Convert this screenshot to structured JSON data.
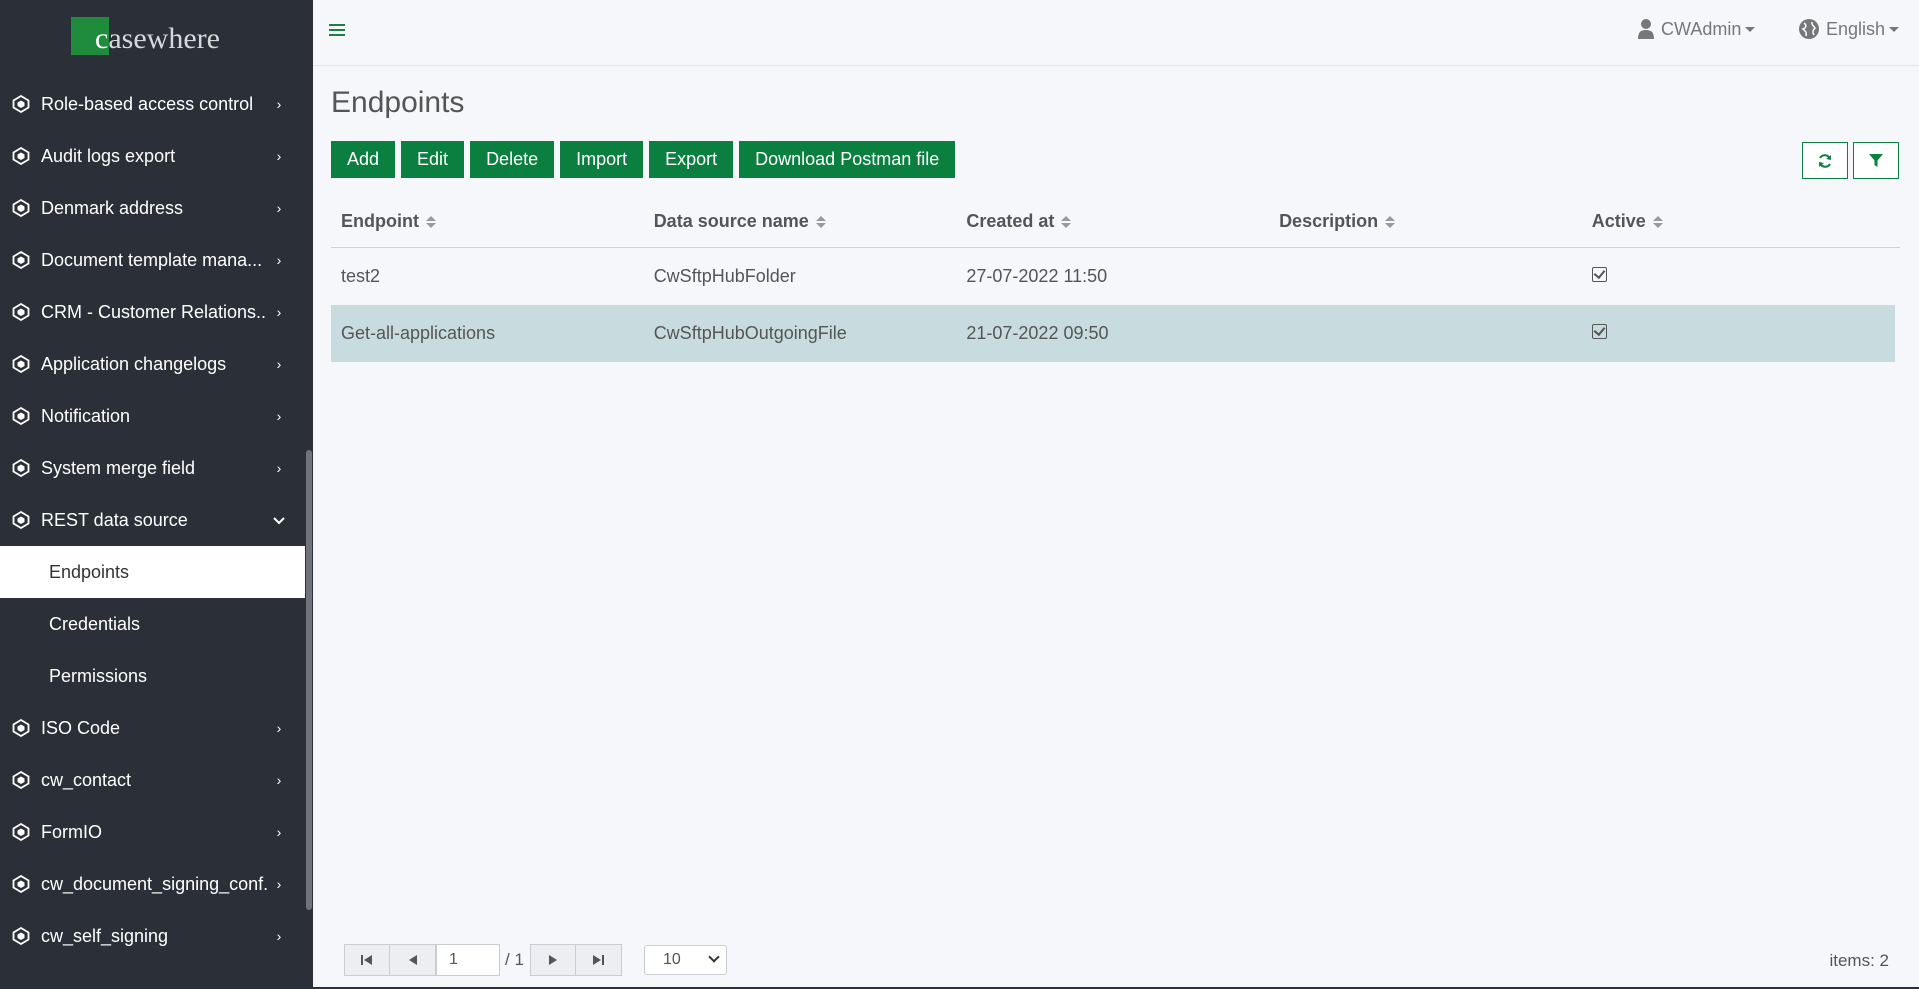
{
  "brand": {
    "logo_first": "c",
    "logo_rest": "asewhere"
  },
  "sidebar": {
    "items": [
      {
        "label": "Role-based access control",
        "chevron": "›"
      },
      {
        "label": "Audit logs export",
        "chevron": "›"
      },
      {
        "label": "Denmark address",
        "chevron": "›"
      },
      {
        "label": "Document template mana...",
        "chevron": "›"
      },
      {
        "label": "CRM - Customer Relations...",
        "chevron": "›"
      },
      {
        "label": "Application changelogs",
        "chevron": "›"
      },
      {
        "label": "Notification",
        "chevron": "›"
      },
      {
        "label": "System merge field",
        "chevron": "›"
      },
      {
        "label": "REST data source",
        "chevron": "⌄"
      }
    ],
    "sub_items": [
      {
        "label": "Endpoints",
        "active": true
      },
      {
        "label": "Credentials"
      },
      {
        "label": "Permissions"
      }
    ],
    "items_after": [
      {
        "label": "ISO Code"
      },
      {
        "label": "cw_contact"
      },
      {
        "label": "FormIO"
      },
      {
        "label": "cw_document_signing_conf..."
      },
      {
        "label": "cw_self_signing"
      }
    ]
  },
  "header": {
    "user": "CWAdmin",
    "language": "English"
  },
  "page": {
    "title": "Endpoints"
  },
  "toolbar": {
    "add": "Add",
    "edit": "Edit",
    "delete": "Delete",
    "import": "Import",
    "export": "Export",
    "postman": "Download Postman file"
  },
  "table": {
    "columns": [
      "Endpoint",
      "Data source name",
      "Created at",
      "Description",
      "Active"
    ],
    "rows": [
      {
        "endpoint": "test2",
        "data_source": "CwSftpHubFolder",
        "created_at": "27-07-2022 11:50",
        "description": "",
        "active": true
      },
      {
        "endpoint": "Get-all-applications",
        "data_source": "CwSftpHubOutgoingFile",
        "created_at": "21-07-2022 09:50",
        "description": "",
        "active": true
      }
    ]
  },
  "pager": {
    "page": "1",
    "total": "/ 1",
    "page_size": "10",
    "items": "items: 2"
  },
  "colors": {
    "sidebar_bg": "#2b3038",
    "accent_green": "#0a7f3f",
    "selected_row": "#c8dce0"
  }
}
